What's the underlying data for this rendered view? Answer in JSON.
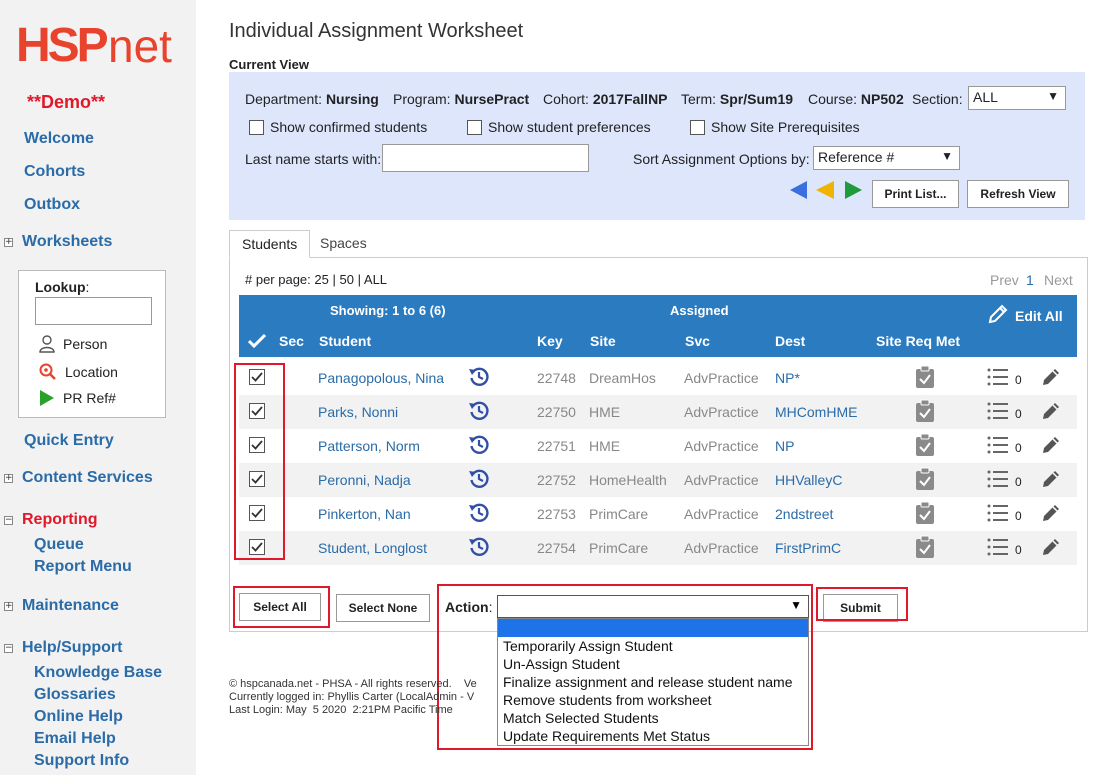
{
  "sidebar": {
    "logo_hsp": "HSP",
    "logo_net": "net",
    "demo": "**Demo**",
    "welcome": "Welcome",
    "cohorts": "Cohorts",
    "outbox": "Outbox",
    "worksheets": "Worksheets",
    "lookup_label": "Lookup",
    "lookup_colon": ":",
    "lookup_person": "Person",
    "lookup_location": "Location",
    "lookup_prref": "PR Ref#",
    "quick_entry": "Quick Entry",
    "content_services": "Content Services",
    "reporting": "Reporting",
    "queue": "Queue",
    "report_menu": "Report Menu",
    "maintenance": "Maintenance",
    "help_support": "Help/Support",
    "knowledge_base": "Knowledge Base",
    "glossaries": "Glossaries",
    "online_help": "Online Help",
    "email_help": "Email Help",
    "support_info": "Support Info",
    "expander_plus": "+",
    "expander_minus": "−"
  },
  "page": {
    "title": "Individual Assignment Worksheet",
    "current_view_label": "Current View"
  },
  "current_view": {
    "dept_label": "Department:",
    "dept_value": "Nursing",
    "program_label": "Program:",
    "program_value": "NursePract",
    "cohort_label": "Cohort:",
    "cohort_value": "2017FallNP",
    "term_label": "Term:",
    "term_value": "Spr/Sum19",
    "course_label": "Course:",
    "course_value": "NP502",
    "section_label": "Section:",
    "section_value": "ALL",
    "show_confirmed": "Show confirmed students",
    "show_preferences": "Show student preferences",
    "show_prereq": "Show Site Prerequisites",
    "lastname_label": "Last name starts with:",
    "lastname_value": "",
    "sort_label": "Sort Assignment Options by:",
    "sort_value": "Reference #",
    "print_list": "Print List...",
    "refresh_view": "Refresh View",
    "dropdown_arrow": "▼"
  },
  "tabs": {
    "students": "Students",
    "spaces": "Spaces"
  },
  "paging": {
    "per_page_label": "# per page:",
    "per_page_25": "25",
    "sep": "|",
    "per_page_50": "50",
    "per_page_all": "ALL",
    "prev": "Prev",
    "page": "1",
    "next": "Next"
  },
  "table": {
    "showing": "Showing: 1 to 6 (6)",
    "assigned": "Assigned",
    "edit_all": "Edit All",
    "col_sec": "Sec",
    "col_student": "Student",
    "col_key": "Key",
    "col_site": "Site",
    "col_svc": "Svc",
    "col_dest": "Dest",
    "col_sitereq": "Site Req Met",
    "rows": [
      {
        "student": "Panagopolous, Nina",
        "key": "22748",
        "site": "DreamHos",
        "svc": "AdvPractice",
        "dest": "NP*",
        "count": "0"
      },
      {
        "student": "Parks, Nonni",
        "key": "22750",
        "site": "HME",
        "svc": "AdvPractice",
        "dest": "MHComHME",
        "count": "0"
      },
      {
        "student": "Patterson, Norm",
        "key": "22751",
        "site": "HME",
        "svc": "AdvPractice",
        "dest": "NP",
        "count": "0"
      },
      {
        "student": "Peronni, Nadja",
        "key": "22752",
        "site": "HomeHealth",
        "svc": "AdvPractice",
        "dest": "HHValleyC",
        "count": "0"
      },
      {
        "student": "Pinkerton, Nan",
        "key": "22753",
        "site": "PrimCare",
        "svc": "AdvPractice",
        "dest": "2ndstreet",
        "count": "0"
      },
      {
        "student": "Student, Longlost",
        "key": "22754",
        "site": "PrimCare",
        "svc": "AdvPractice",
        "dest": "FirstPrimC",
        "count": "0"
      }
    ]
  },
  "actions": {
    "select_all": "Select All",
    "select_none": "Select None",
    "action_label": "Action",
    "action_colon": ":",
    "action_value": "",
    "submit": "Submit",
    "dropdown_arrow": "▼",
    "options": [
      "Temporarily Assign Student",
      "Un-Assign Student",
      "Finalize assignment and release student name",
      "Remove students from worksheet",
      "Match Selected Students",
      "Update Requirements Met Status"
    ]
  },
  "footer": {
    "line1": "© hspcanada.net - PHSA - All rights reserved.    Ve",
    "line2": "Currently logged in: Phyllis Carter (LocalAdmin - V",
    "line3": "Last Login: May  5 2020  2:21PM Pacific Time"
  },
  "colors": {
    "brand_red": "#e8432d",
    "link_blue": "#2a6ba8",
    "header_blue": "#2b7bc1",
    "panel_blue": "#dde6fb",
    "highlight_red": "#e0182a"
  }
}
